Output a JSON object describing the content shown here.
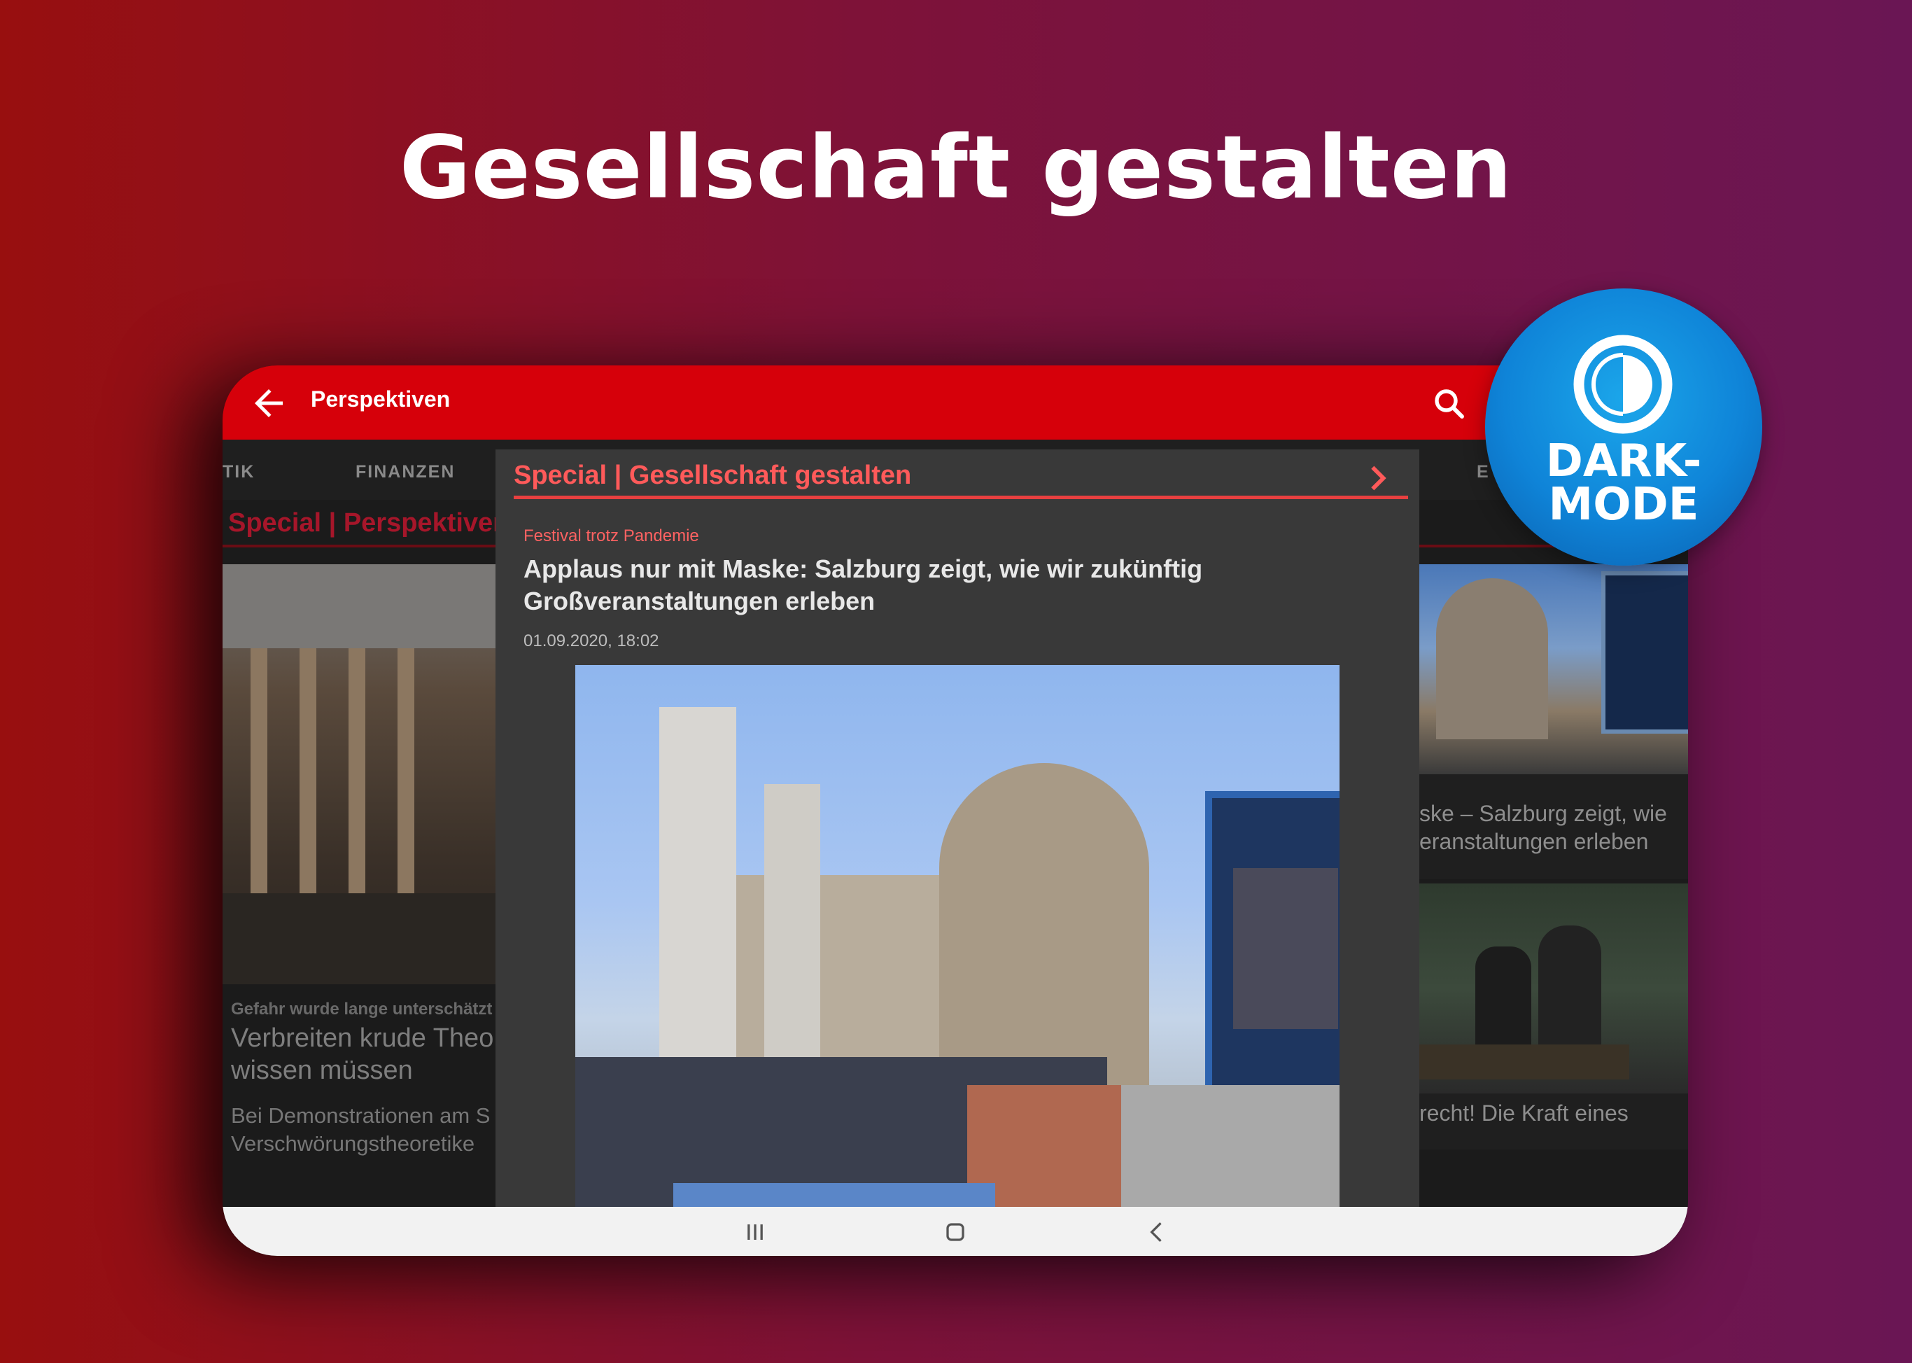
{
  "promo": {
    "headline": "Gesellschaft gestalten",
    "badge_line1": "DARK-",
    "badge_line2": "MODE"
  },
  "appbar": {
    "title": "Perspektiven",
    "back_icon": "arrow-left-icon",
    "search_icon": "search-icon"
  },
  "tabs": [
    "TIK",
    "FINANZEN",
    "E"
  ],
  "background_feed": {
    "section_title": "Special | Perspektiven",
    "left_card": {
      "kicker": "Gefahr wurde lange unterschätzt",
      "title": "Verbreiten krude Theo wissen müssen",
      "teaser": "Bei Demonstrationen am S Verschwörungstheoretike"
    },
    "right_card_1": {
      "title": "ske – Salzburg zeigt, wie eranstaltungen erleben"
    },
    "right_card_2": {
      "title": "recht! Die Kraft eines"
    }
  },
  "dialog": {
    "title": "Special | Gesellschaft gestalten",
    "chevron_icon": "chevron-right-icon",
    "article": {
      "kicker": "Festival trotz Pandemie",
      "title": "Applaus nur mit Maske: Salzburg zeigt, wie wir zukünftig Großveranstaltungen erleben",
      "date": "01.09.2020, 18:02"
    }
  },
  "navbar": {
    "recents_icon": "recents-icon",
    "home_icon": "home-icon",
    "back_icon": "back-chevron-icon"
  },
  "colors": {
    "brand_red": "#d6000a",
    "accent_red": "#ff5a5a",
    "badge_blue": "#0f84d8",
    "dialog_bg": "#393939"
  }
}
